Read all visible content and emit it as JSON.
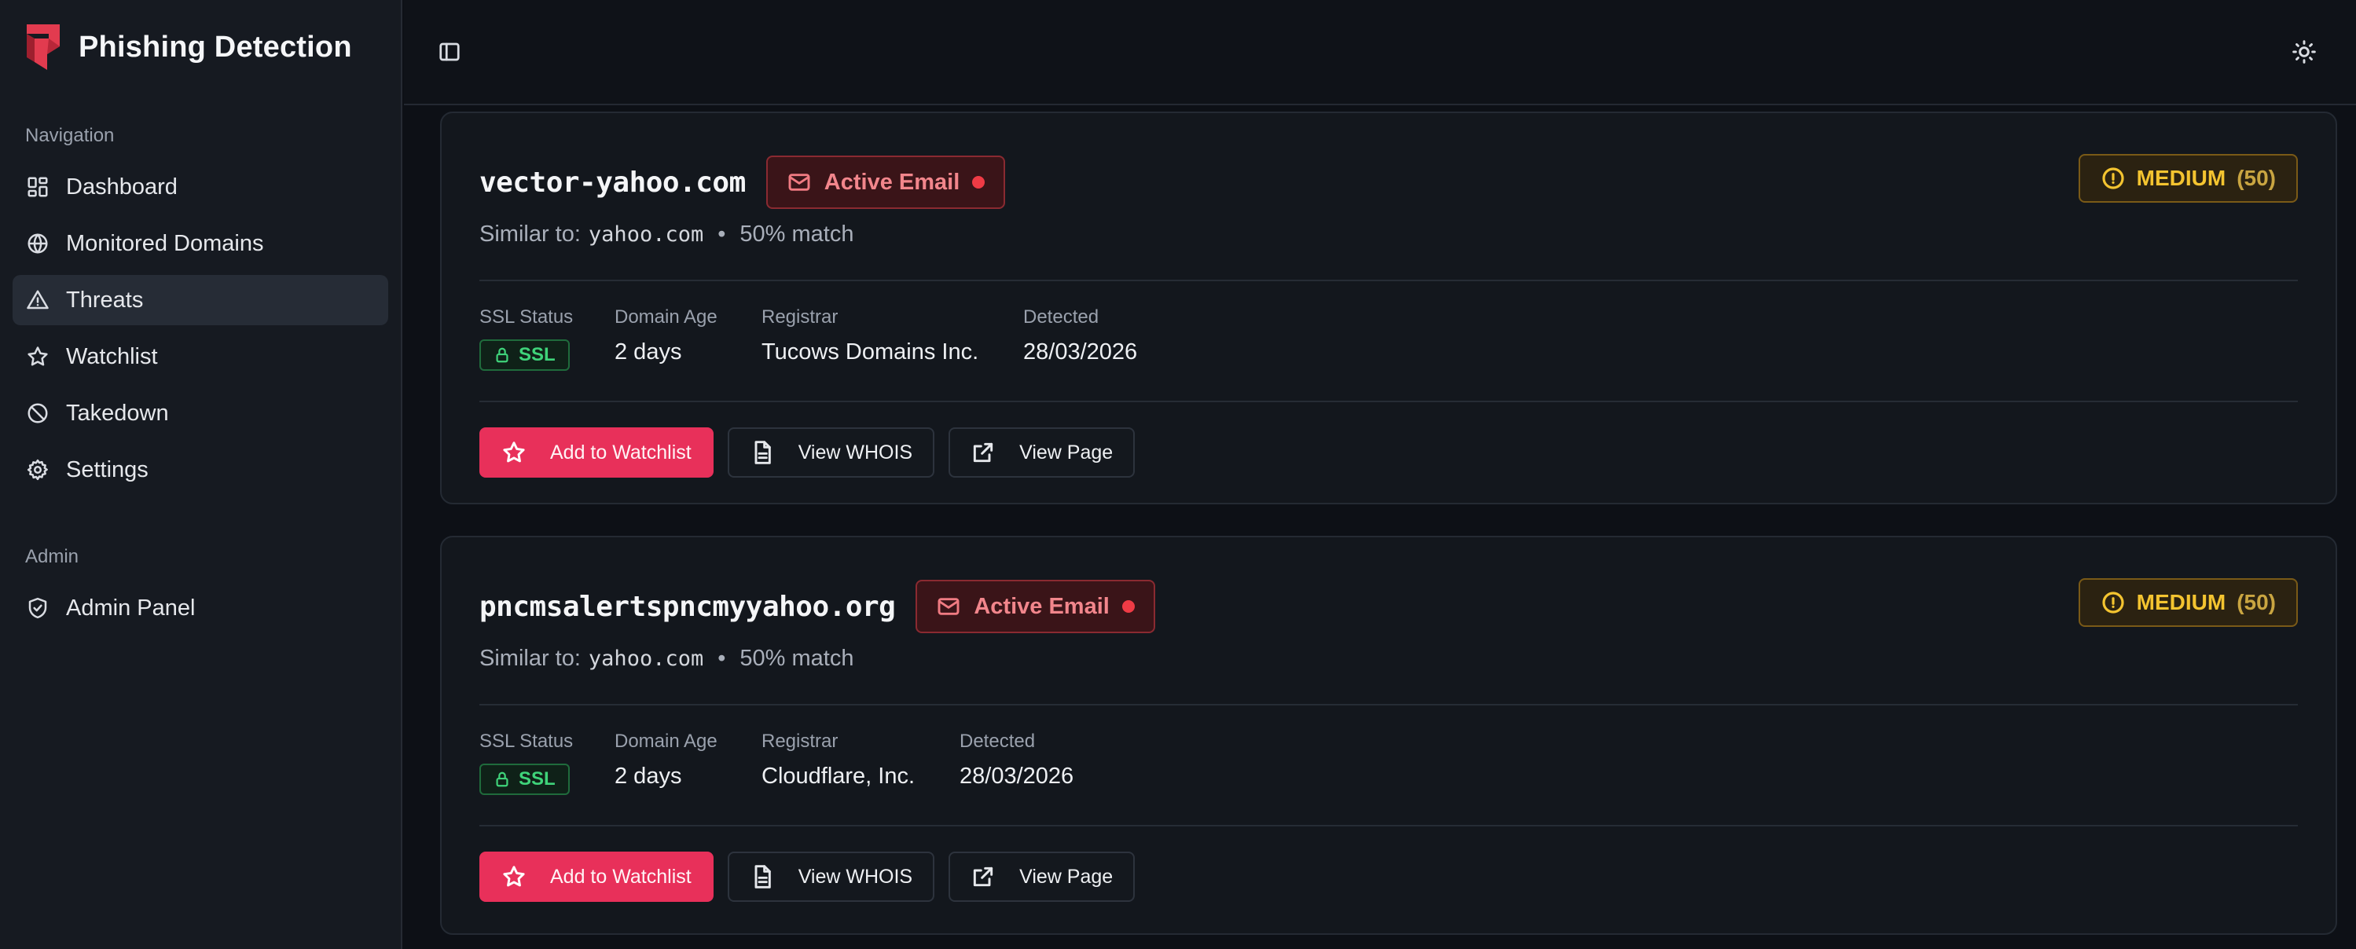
{
  "app": {
    "title": "Phishing Detection"
  },
  "colors": {
    "accent": "#e8305a",
    "brand": "#e23b4f",
    "warning": "#f4c430",
    "success": "#3fd37a",
    "danger": "#ef3b45"
  },
  "sidebar": {
    "nav_label": "Navigation",
    "items": [
      {
        "label": "Dashboard",
        "icon": "dashboard-icon"
      },
      {
        "label": "Monitored Domains",
        "icon": "globe-icon"
      },
      {
        "label": "Threats",
        "icon": "alert-triangle-icon",
        "active": true
      },
      {
        "label": "Watchlist",
        "icon": "star-icon"
      },
      {
        "label": "Takedown",
        "icon": "ban-icon"
      },
      {
        "label": "Settings",
        "icon": "gear-icon"
      }
    ],
    "admin_label": "Admin",
    "admin_items": [
      {
        "label": "Admin Panel",
        "icon": "shield-check-icon"
      }
    ]
  },
  "threats": [
    {
      "domain": "vector-yahoo.com",
      "email_badge": "Active Email",
      "severity": "MEDIUM",
      "score": "(50)",
      "similar_prefix": "Similar to:",
      "similar_domain": "yahoo.com",
      "match": "50% match",
      "ssl_label": "SSL Status",
      "ssl_value": "SSL",
      "age_label": "Domain Age",
      "age_value": "2 days",
      "registrar_label": "Registrar",
      "registrar_value": "Tucows Domains Inc.",
      "detected_label": "Detected",
      "detected_value": "28/03/2026",
      "watch_label": "Add to Watchlist",
      "whois_label": "View WHOIS",
      "page_label": "View Page"
    },
    {
      "domain": "pncmsalertspncmyyahoo.org",
      "email_badge": "Active Email",
      "severity": "MEDIUM",
      "score": "(50)",
      "similar_prefix": "Similar to:",
      "similar_domain": "yahoo.com",
      "match": "50% match",
      "ssl_label": "SSL Status",
      "ssl_value": "SSL",
      "age_label": "Domain Age",
      "age_value": "2 days",
      "registrar_label": "Registrar",
      "registrar_value": "Cloudflare, Inc.",
      "detected_label": "Detected",
      "detected_value": "28/03/2026",
      "watch_label": "Add to Watchlist",
      "whois_label": "View WHOIS",
      "page_label": "View Page"
    }
  ]
}
